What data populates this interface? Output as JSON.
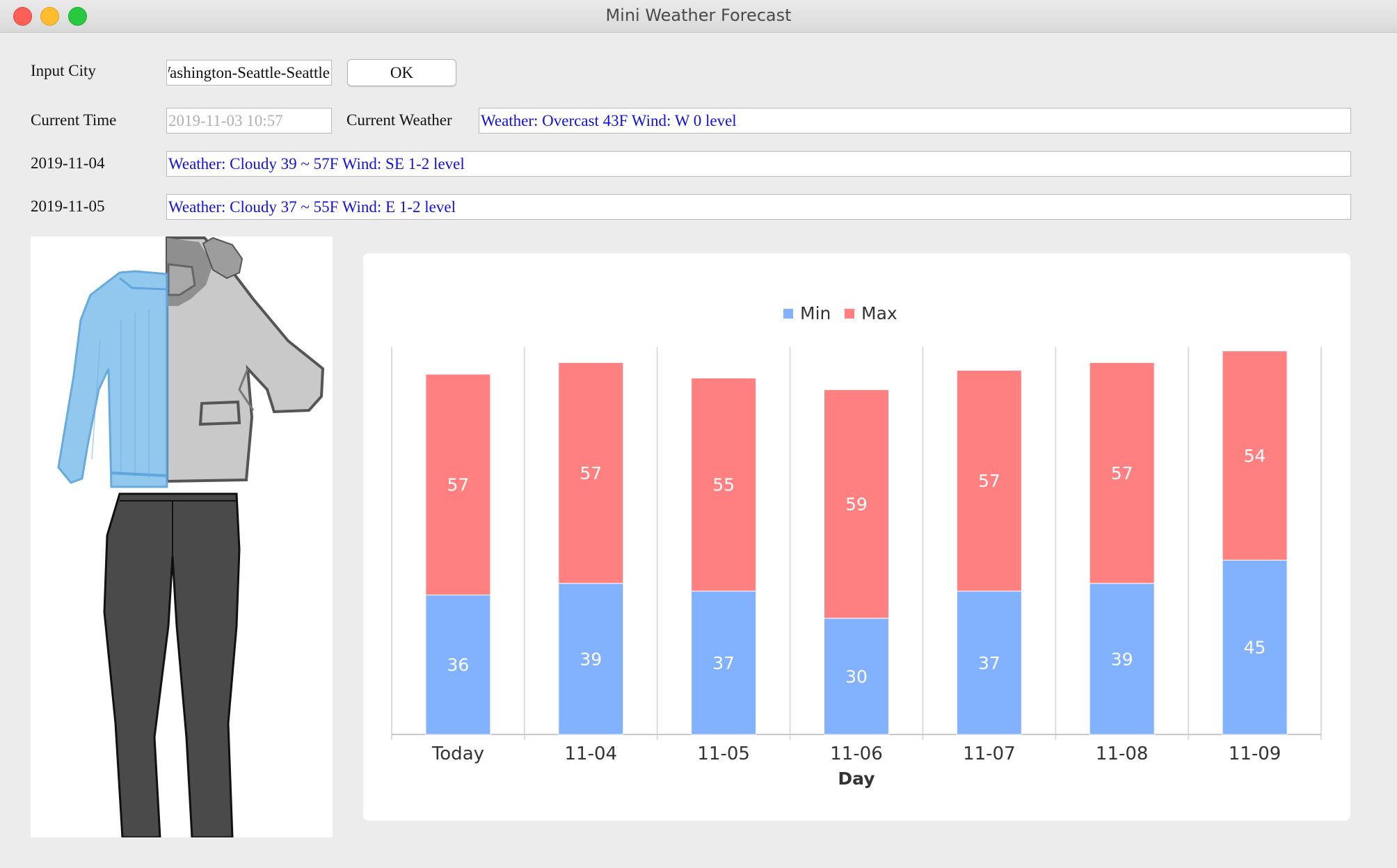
{
  "window": {
    "title": "Mini Weather Forecast"
  },
  "form": {
    "input_city_label": "Input City",
    "city_value": "Washington-Seattle-Seattle",
    "ok_label": "OK",
    "current_time_label": "Current Time",
    "current_time_value": "2019-11-03 10:57",
    "current_weather_label": "Current Weather",
    "current_weather_value": "Weather: Overcast  43F  Wind: W  0 level"
  },
  "forecast": [
    {
      "date": "2019-11-04",
      "text": "Weather: Cloudy  39 ~ 57F  Wind: SE 1-2 level"
    },
    {
      "date": "2019-11-05",
      "text": "Weather: Cloudy  37 ~ 55F  Wind: E 1-2 level"
    }
  ],
  "colors": {
    "min": "#82b1fd",
    "max": "#ff8080",
    "weather_text": "#1010e0"
  },
  "icons": {
    "clothing": "sweater-jacket-pants-outfit"
  },
  "chart_data": {
    "type": "bar",
    "stacked": true,
    "categories": [
      "Today",
      "11-04",
      "11-05",
      "11-06",
      "11-07",
      "11-08",
      "11-09"
    ],
    "series": [
      {
        "name": "Min",
        "values": [
          36,
          39,
          37,
          30,
          37,
          39,
          45
        ],
        "color": "#82b1fd"
      },
      {
        "name": "Max",
        "values": [
          57,
          57,
          55,
          59,
          57,
          57,
          54
        ],
        "color": "#ff8080"
      }
    ],
    "xlabel": "Day",
    "ylabel": "",
    "ylim": [
      0,
      100
    ],
    "legend": "top-center",
    "grid": "vertical"
  }
}
